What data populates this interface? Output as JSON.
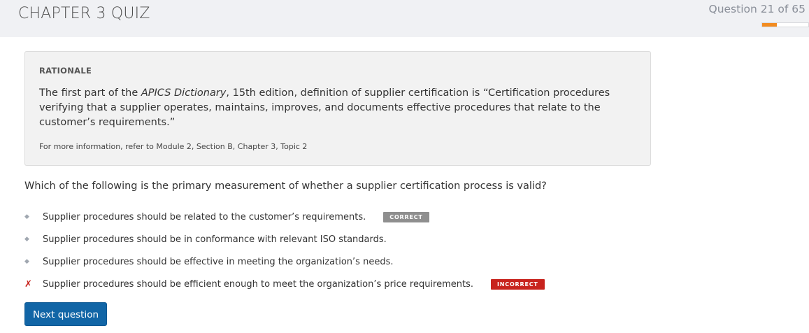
{
  "header": {
    "title": "CHAPTER 3 QUIZ",
    "question_counter": "Question 21 of 65",
    "progress_fraction": 0.32,
    "progress_color": "#f28b1f"
  },
  "rationale": {
    "heading": "RATIONALE",
    "body_prefix": "The first part of the ",
    "body_italic": "APICS Dictionary",
    "body_suffix": ", 15th edition, definition of supplier certification is “Certification procedures verifying that a supplier operates, maintains, improves, and documents effective procedures that relate to the customer’s requirements.”",
    "reference": "For more information, refer to Module 2, Section B, Chapter 3, Topic 2"
  },
  "question": {
    "text": "Which of the following is the primary measurement of whether a supplier certification process is valid?"
  },
  "options": [
    {
      "marker": "◆",
      "marker_icon": "diamond-bullet-icon",
      "text": "Supplier procedures should be related to the customer’s requirements.",
      "badge": "CORRECT"
    },
    {
      "marker": "◆",
      "marker_icon": "diamond-bullet-icon",
      "text": "Supplier procedures should be in conformance with relevant ISO standards.",
      "badge": ""
    },
    {
      "marker": "◆",
      "marker_icon": "diamond-bullet-icon",
      "text": "Supplier procedures should be effective in meeting the organization’s needs.",
      "badge": ""
    },
    {
      "marker": "✗",
      "marker_icon": "cross-mark-icon",
      "text": "Supplier procedures should be efficient enough to meet the organization’s price requirements.",
      "badge": "INCORRECT"
    }
  ],
  "colors": {
    "correct_badge": "#8f8f8f",
    "incorrect_badge": "#c8231d",
    "primary_button": "#1165a6"
  },
  "actions": {
    "next_label": "Next question"
  }
}
